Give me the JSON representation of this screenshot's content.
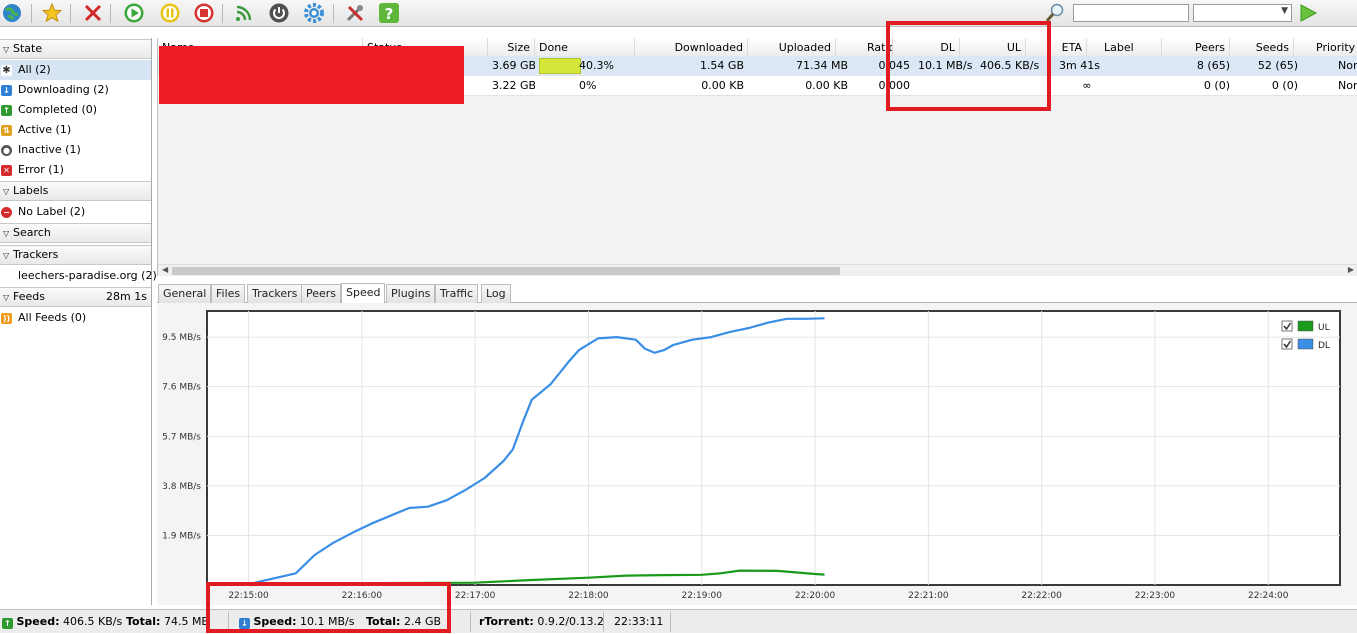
{
  "colors": {
    "accent": "#2f8de4",
    "ul_series": "#1a9a1a",
    "dl_series": "#3a8ee6",
    "annotation": "#e21a22",
    "progress_fill": "#d4e637"
  },
  "toolbar": {
    "icons": [
      "globe-icon",
      "star-icon",
      "remove-icon",
      "start-icon",
      "pause-icon",
      "stop-icon",
      "rss-icon",
      "power-icon",
      "settings-icon",
      "tools-icon",
      "help-icon"
    ],
    "search_value": "",
    "search_select_value": ""
  },
  "sidebar": {
    "state": {
      "title": "State",
      "items": [
        {
          "label": "All (2)",
          "icon": "all-icon"
        },
        {
          "label": "Downloading (2)",
          "icon": "downloading-icon"
        },
        {
          "label": "Completed (0)",
          "icon": "completed-icon"
        },
        {
          "label": "Active (1)",
          "icon": "active-icon"
        },
        {
          "label": "Inactive (1)",
          "icon": "inactive-icon"
        },
        {
          "label": "Error (1)",
          "icon": "error-icon"
        }
      ]
    },
    "labels": {
      "title": "Labels",
      "items": [
        {
          "label": "No Label (2)",
          "icon": "no-label-icon"
        }
      ]
    },
    "search": {
      "title": "Search"
    },
    "trackers": {
      "title": "Trackers",
      "items": [
        {
          "label": "leechers-paradise.org (2)"
        }
      ]
    },
    "feeds": {
      "title": "Feeds",
      "timer": "28m 1s",
      "items": [
        {
          "label": "All Feeds (0)",
          "icon": "rss-feed-icon"
        }
      ]
    }
  },
  "list": {
    "columns": [
      "Name",
      "Status",
      "Size",
      "Done",
      "Downloaded",
      "Uploaded",
      "Ratio",
      "DL",
      "UL",
      "ETA",
      "Label",
      "Peers",
      "Seeds",
      "Priority"
    ],
    "rows": [
      {
        "size": "3.69 GB",
        "done": "40.3%",
        "progress": 0.403,
        "downloaded": "1.54 GB",
        "uploaded": "71.34 MB",
        "ratio": "0.045",
        "dl": "10.1 MB/s",
        "ul": "406.5 KB/s",
        "eta": "3m 41s",
        "label": "",
        "peers": "8 (65)",
        "seeds": "52 (65)",
        "priority": "Normal"
      },
      {
        "size": "3.22 GB",
        "done": "0%",
        "progress": 0,
        "downloaded": "0.00 KB",
        "uploaded": "0.00 KB",
        "ratio": "0.000",
        "dl": "",
        "ul": "",
        "eta": "∞",
        "label": "",
        "peers": "0 (0)",
        "seeds": "0 (0)",
        "priority": "Normal"
      }
    ]
  },
  "tabs": [
    "General",
    "Files",
    "Trackers",
    "Peers",
    "Speed",
    "Plugins",
    "Traffic",
    "Log"
  ],
  "active_tab": "Speed",
  "chart_data": {
    "type": "line",
    "title": "",
    "xlabel": "",
    "ylabel": "",
    "x_ticks": [
      "22:15:00",
      "22:16:00",
      "22:17:00",
      "22:18:00",
      "22:19:00",
      "22:20:00",
      "22:21:00",
      "22:22:00",
      "22:23:00",
      "22:24:00"
    ],
    "y_ticks": [
      "1.9 MB/s",
      "3.8 MB/s",
      "5.7 MB/s",
      "7.6 MB/s",
      "9.5 MB/s"
    ],
    "xlim": [
      "22:14:38",
      "22:24:38"
    ],
    "ylim": [
      0,
      10.5
    ],
    "grid": true,
    "legend": "top-right",
    "series": [
      {
        "name": "UL",
        "x": [
          "22:15:00",
          "22:16:00",
          "22:17:00",
          "22:17:30",
          "22:18:00",
          "22:18:20",
          "22:18:40",
          "22:19:00",
          "22:19:10",
          "22:19:20",
          "22:19:40",
          "22:20:00",
          "22:20:05"
        ],
        "y": [
          0,
          0.07,
          0.09,
          0.19,
          0.28,
          0.36,
          0.38,
          0.39,
          0.45,
          0.55,
          0.54,
          0.42,
          0.4
        ]
      },
      {
        "name": "DL",
        "x": [
          "22:15:00",
          "22:15:05",
          "22:15:15",
          "22:15:25",
          "22:15:35",
          "22:15:45",
          "22:15:55",
          "22:16:05",
          "22:16:15",
          "22:16:25",
          "22:16:35",
          "22:16:45",
          "22:16:55",
          "22:17:05",
          "22:17:15",
          "22:17:20",
          "22:17:25",
          "22:17:30",
          "22:17:40",
          "22:17:50",
          "22:17:55",
          "22:18:05",
          "22:18:15",
          "22:18:25",
          "22:18:30",
          "22:18:35",
          "22:18:40",
          "22:18:45",
          "22:18:55",
          "22:19:05",
          "22:19:15",
          "22:19:25",
          "22:19:35",
          "22:19:45",
          "22:19:55",
          "22:20:05"
        ],
        "y": [
          0,
          0.12,
          0.28,
          0.45,
          1.15,
          1.62,
          2.0,
          2.35,
          2.65,
          2.95,
          3.0,
          3.25,
          3.65,
          4.1,
          4.75,
          5.2,
          6.2,
          7.1,
          7.7,
          8.6,
          9.0,
          9.45,
          9.5,
          9.4,
          9.05,
          8.9,
          9.0,
          9.2,
          9.4,
          9.5,
          9.7,
          9.85,
          10.05,
          10.2,
          10.2,
          10.22
        ]
      }
    ]
  },
  "statusbar": {
    "ul_speed_label": "Speed:",
    "ul_speed": "406.5 KB/s",
    "ul_total_label": "Total:",
    "ul_total": "74.5 MB",
    "dl_speed_label": "Speed:",
    "dl_speed": "10.1 MB/s",
    "dl_total_label": "Total:",
    "dl_total": "2.4 GB",
    "client_label": "rTorrent:",
    "client_version": "0.9.2/0.13.2",
    "clock": "22:33:11"
  }
}
